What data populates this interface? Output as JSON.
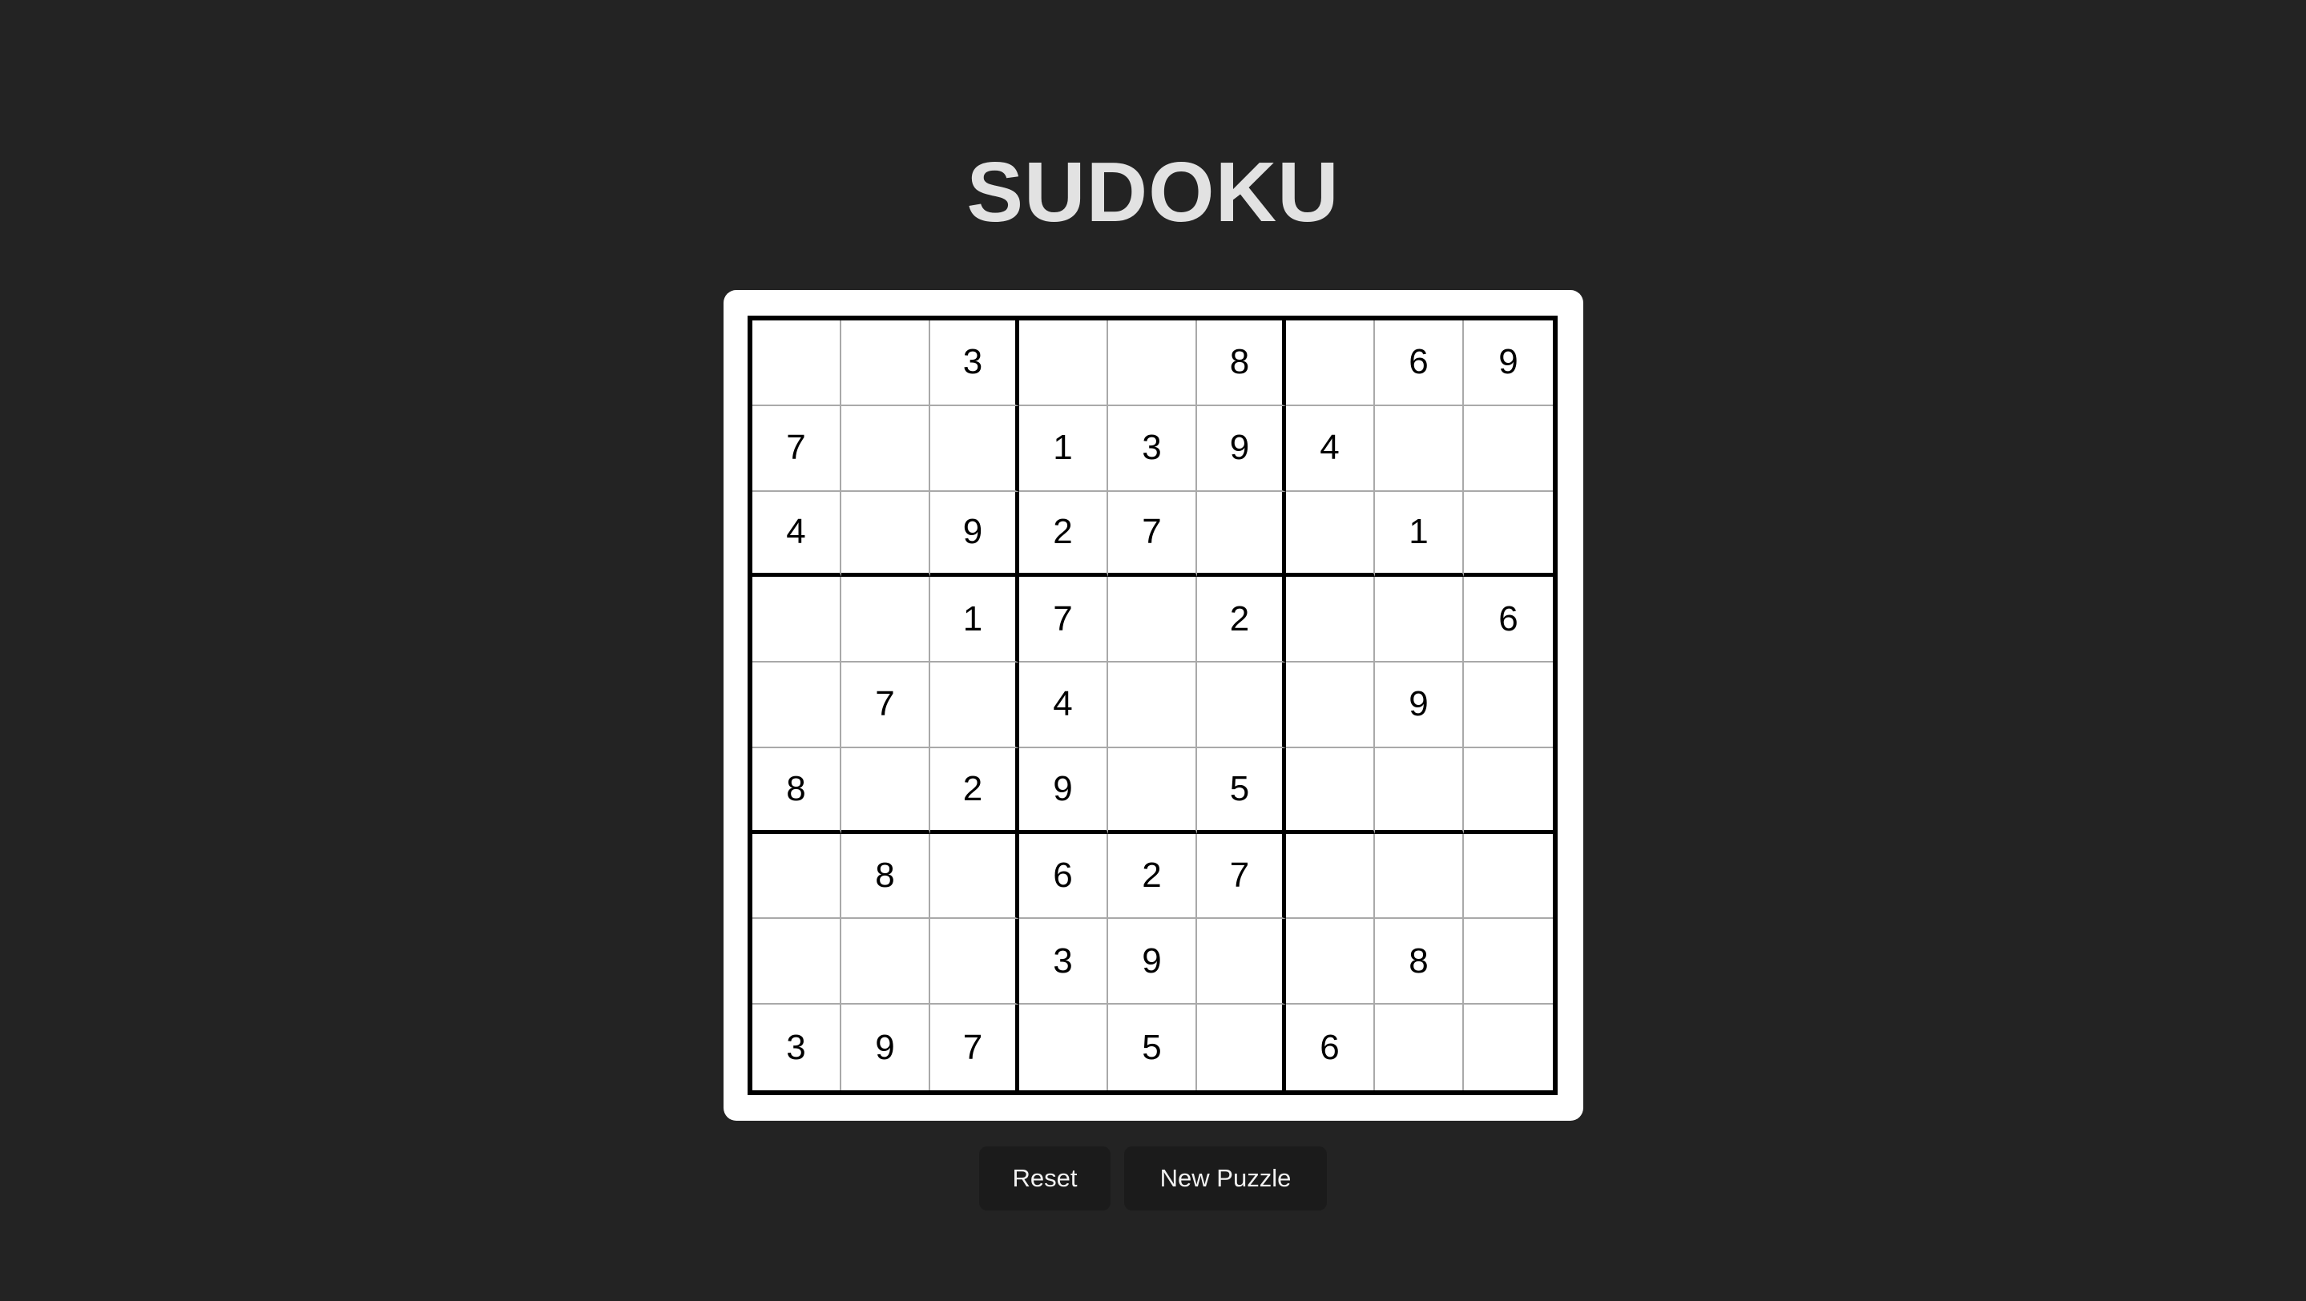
{
  "title": "SUDOKU",
  "colors": {
    "background": "#232323",
    "title": "#e2e2e2",
    "board": "#ffffff",
    "button_bg": "#1b1b1b",
    "button_text": "#f2f2f2"
  },
  "board": {
    "rows": [
      [
        "",
        "",
        "3",
        "",
        "",
        "8",
        "",
        "6",
        "9"
      ],
      [
        "7",
        "",
        "",
        "1",
        "3",
        "9",
        "4",
        "",
        ""
      ],
      [
        "4",
        "",
        "9",
        "2",
        "7",
        "",
        "",
        "1",
        ""
      ],
      [
        "",
        "",
        "1",
        "7",
        "",
        "2",
        "",
        "",
        "6"
      ],
      [
        "",
        "7",
        "",
        "4",
        "",
        "",
        "",
        "9",
        ""
      ],
      [
        "8",
        "",
        "2",
        "9",
        "",
        "5",
        "",
        "",
        ""
      ],
      [
        "",
        "8",
        "",
        "6",
        "2",
        "7",
        "",
        "",
        ""
      ],
      [
        "",
        "",
        "",
        "3",
        "9",
        "",
        "",
        "8",
        ""
      ],
      [
        "3",
        "9",
        "7",
        "",
        "5",
        "",
        "6",
        "",
        ""
      ]
    ]
  },
  "controls": {
    "reset_label": "Reset",
    "new_puzzle_label": "New Puzzle"
  }
}
